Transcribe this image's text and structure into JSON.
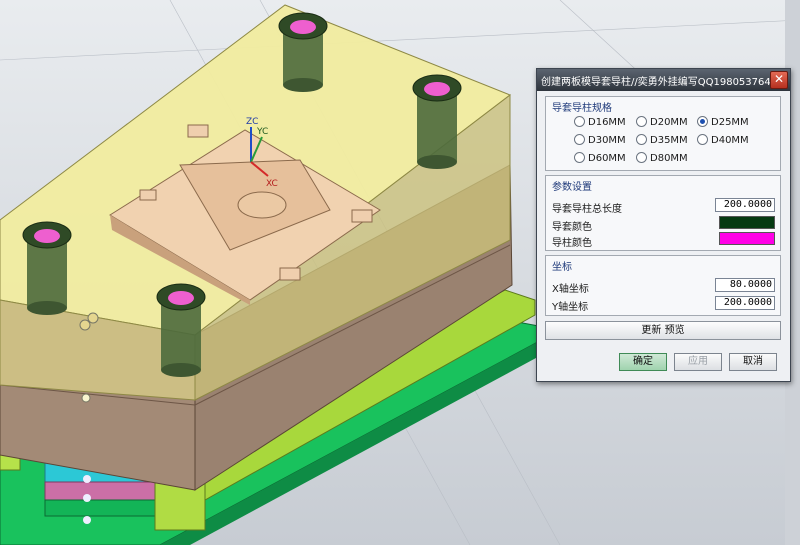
{
  "dialog": {
    "title": "创建两板模导套导柱//奕勇外挂编写QQ1980537648",
    "close_symbol": "✕",
    "groups": {
      "spec": {
        "header": "导套导柱规格",
        "options": [
          "D16MM",
          "D20MM",
          "D25MM",
          "D30MM",
          "D35MM",
          "D40MM",
          "D60MM",
          "D80MM"
        ],
        "selected": "D25MM"
      },
      "params": {
        "header": "参数设置",
        "total_length_label": "导套导柱总长度",
        "total_length_value": "200.0000",
        "sleeve_color_label": "导套颜色",
        "sleeve_color": "#063a12",
        "pillar_color_label": "导柱颜色",
        "pillar_color": "#ff00e6"
      },
      "coords": {
        "header": "坐标",
        "x_label": "X轴坐标",
        "x_value": "80.0000",
        "y_label": "Y轴坐标",
        "y_value": "200.0000"
      }
    },
    "update_preview_label": "更新   预览",
    "ok_label": "确定",
    "apply_label": "应用",
    "cancel_label": "取消"
  },
  "viewport": {
    "axis_labels": {
      "zc": "ZC",
      "yc": "YC",
      "xc": "XC"
    },
    "colors": {
      "plate_top": "#f3efb4",
      "plate_side": "#a88e78",
      "guide_green": "#4f6a3e",
      "pillar_pink": "#ee5fcf",
      "base_green": "#15c15c",
      "lime": "#a7d83d"
    }
  }
}
